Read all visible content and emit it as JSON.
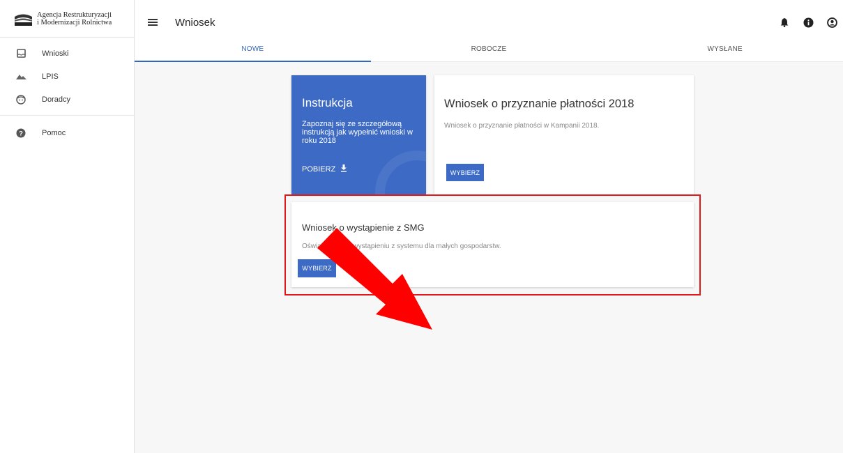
{
  "brand": {
    "line1": "Agencja Restrukturyzacji",
    "line2": "i Modernizacji Rolnictwa"
  },
  "sidebar": {
    "items": [
      {
        "label": "Wnioski",
        "icon": "inbox-icon"
      },
      {
        "label": "LPIS",
        "icon": "terrain-icon"
      },
      {
        "label": "Doradcy",
        "icon": "face-icon"
      },
      {
        "label": "Pomoc",
        "icon": "help-icon"
      }
    ]
  },
  "header": {
    "title": "Wniosek",
    "icons": [
      "bell-icon",
      "info-icon",
      "account-icon"
    ]
  },
  "tabs": [
    {
      "label": "NOWE",
      "active": true
    },
    {
      "label": "ROBOCZE",
      "active": false
    },
    {
      "label": "WYSŁANE",
      "active": false
    }
  ],
  "cards": {
    "instrukcja": {
      "title": "Instrukcja",
      "text": "Zapoznaj się ze szczegółową instrukcją jak wypełnić wnioski w roku 2018",
      "action": "POBIERZ"
    },
    "platnosci": {
      "title": "Wniosek o przyznanie płatności 2018",
      "text": "Wniosek o przyznanie płatności w Kampanii 2018.",
      "action": "WYBIERZ"
    },
    "smg": {
      "title": "Wniosek o wystąpienie z SMG",
      "text": "Oświadczenie o wystąpieniu z systemu dla małych gospodarstw.",
      "action": "WYBIERZ"
    }
  },
  "colors": {
    "primary": "#3c6ac4",
    "highlight": "#e4171b",
    "arrow": "#ff0000",
    "background": "#f7f7f7"
  }
}
